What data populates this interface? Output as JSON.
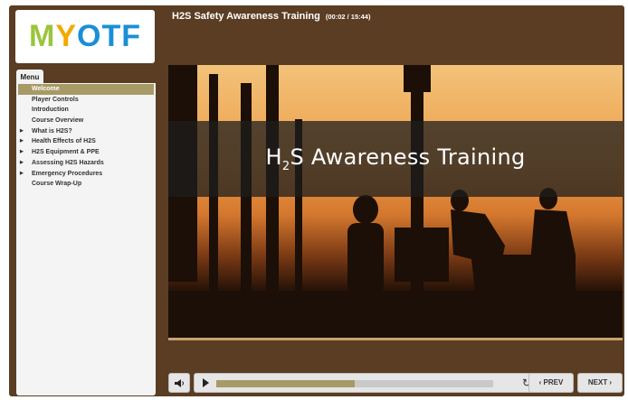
{
  "logo": {
    "text_m": "M",
    "text_y": "Y",
    "text_otf": "OTF",
    "colors": {
      "m": "#9bc53d",
      "y": "#f2a900",
      "otf": "#1a8fd6"
    }
  },
  "header": {
    "title": "H2S Safety Awareness Training",
    "time": "(00:02 / 15:44)"
  },
  "menu": {
    "tab_label": "Menu",
    "items": [
      {
        "label": "Welcome",
        "active": true,
        "expandable": false
      },
      {
        "label": "Player Controls",
        "expandable": false
      },
      {
        "label": "Introduction",
        "expandable": false
      },
      {
        "label": "Course Overview",
        "expandable": false
      },
      {
        "label": "What is H2S?",
        "expandable": true
      },
      {
        "label": "Health Effects of H2S",
        "expandable": true
      },
      {
        "label": "H2S Equipment & PPE",
        "expandable": true
      },
      {
        "label": "Assessing H2S Hazards",
        "expandable": true
      },
      {
        "label": "Emergency Procedures",
        "expandable": true
      },
      {
        "label": "Course Wrap-Up",
        "expandable": false
      }
    ]
  },
  "slide": {
    "title_pre": "H",
    "title_sub": "2",
    "title_post": "S Awareness Training"
  },
  "player": {
    "progress_fraction": 0.5,
    "prev_label": "‹ PREV",
    "next_label": "NEXT ›",
    "mute_icon": "speaker-icon",
    "play_icon": "play-icon",
    "replay_icon": "replay-icon",
    "replay_glyph": "↻"
  }
}
